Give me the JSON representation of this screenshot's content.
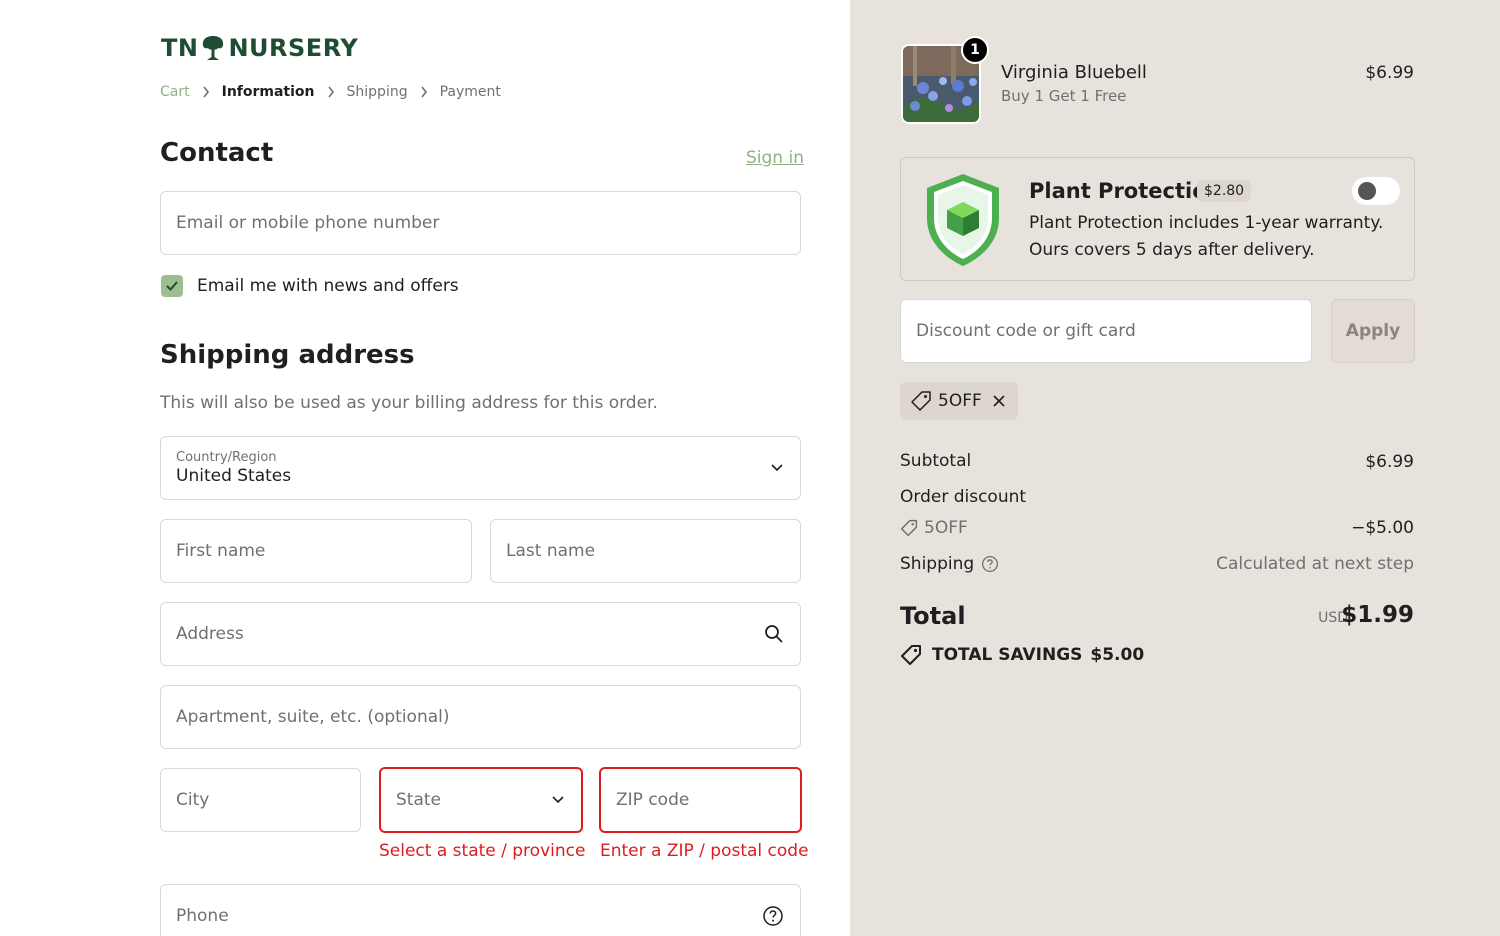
{
  "brand": {
    "logo_left": "TN",
    "logo_right": "NURSERY"
  },
  "breadcrumb": [
    "Cart",
    "Information",
    "Shipping",
    "Payment"
  ],
  "contact": {
    "title": "Contact",
    "sign_in": "Sign in",
    "email_placeholder": "Email or mobile phone number",
    "newsletter_label": "Email me with news and offers",
    "newsletter_checked": true
  },
  "shipping": {
    "title": "Shipping address",
    "note": "This will also be used as your billing address for this order.",
    "country_label": "Country/Region",
    "country_value": "United States",
    "first_name": "First name",
    "last_name": "Last name",
    "address": "Address",
    "apartment": "Apartment, suite, etc. (optional)",
    "city": "City",
    "state": "State",
    "zip": "ZIP code",
    "state_error": "Select a state / province",
    "zip_error": "Enter a ZIP / postal code",
    "phone": "Phone"
  },
  "summary": {
    "item": {
      "quantity": "1",
      "name": "Virginia Bluebell",
      "offer": "Buy 1 Get 1 Free",
      "price": "$6.99"
    },
    "protection": {
      "title": "Plant Protection",
      "price": "$2.80",
      "line1": "Plant Protection includes 1-year warranty.",
      "line2": "Ours covers 5 days after delivery.",
      "enabled": false
    },
    "discount_placeholder": "Discount code or gift card",
    "apply_label": "Apply",
    "applied_code": "5OFF",
    "subtotal_label": "Subtotal",
    "subtotal_value": "$6.99",
    "order_discount_label": "Order discount",
    "discount_code": "5OFF",
    "discount_value": "−$5.00",
    "shipping_label": "Shipping",
    "shipping_value": "Calculated at next step",
    "total_label": "Total",
    "currency": "USD",
    "total_value": "$1.99",
    "savings_label": "TOTAL SAVINGS",
    "savings_value": "$5.00"
  },
  "colors": {
    "accent_green": "#8fb283",
    "brand_green": "#1f4d33",
    "error_red": "#dd1d1d",
    "panel_bg": "#e8e2dc"
  }
}
